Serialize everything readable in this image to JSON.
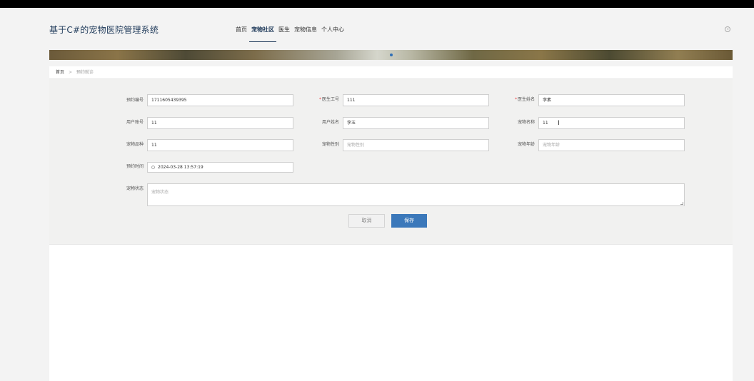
{
  "app": {
    "title": "基于C#的宠物医院管理系统"
  },
  "nav": {
    "items": [
      {
        "label": "首页",
        "active": false
      },
      {
        "label": "宠物社区",
        "active": true
      },
      {
        "label": "医生",
        "active": false
      },
      {
        "label": "宠物信息",
        "active": false
      },
      {
        "label": "个人中心",
        "active": false
      }
    ]
  },
  "breadcrumb": {
    "home": "首页",
    "separator": ">",
    "current": "预约就诊"
  },
  "form": {
    "appointment_no": {
      "label": "预约编号",
      "value": "1711605439395"
    },
    "doctor_id": {
      "label": "医生工号",
      "value": "111",
      "required": true
    },
    "doctor_name": {
      "label": "医生姓名",
      "value": "李素",
      "required": true
    },
    "user_account": {
      "label": "用户账号",
      "value": "11"
    },
    "user_name": {
      "label": "用户姓名",
      "value": "李玉"
    },
    "pet_name": {
      "label": "宠物名称",
      "value": "11"
    },
    "pet_breed": {
      "label": "宠物品种",
      "value": "11"
    },
    "pet_gender": {
      "label": "宠物性别",
      "placeholder": "宠物性别"
    },
    "pet_age": {
      "label": "宠物年龄",
      "placeholder": "宠物年龄"
    },
    "appointment_time": {
      "label": "预约时间",
      "value": "2024-03-28 13:57:19"
    },
    "pet_status": {
      "label": "宠物状态",
      "placeholder": "宠物状态"
    },
    "cancel_label": "取消",
    "save_label": "保存"
  },
  "colors": {
    "accent": "#3b78ba",
    "title": "#1f3a5a",
    "required": "#e44444"
  },
  "icons": {
    "clock": "clock-icon",
    "calendar": "date-icon"
  }
}
